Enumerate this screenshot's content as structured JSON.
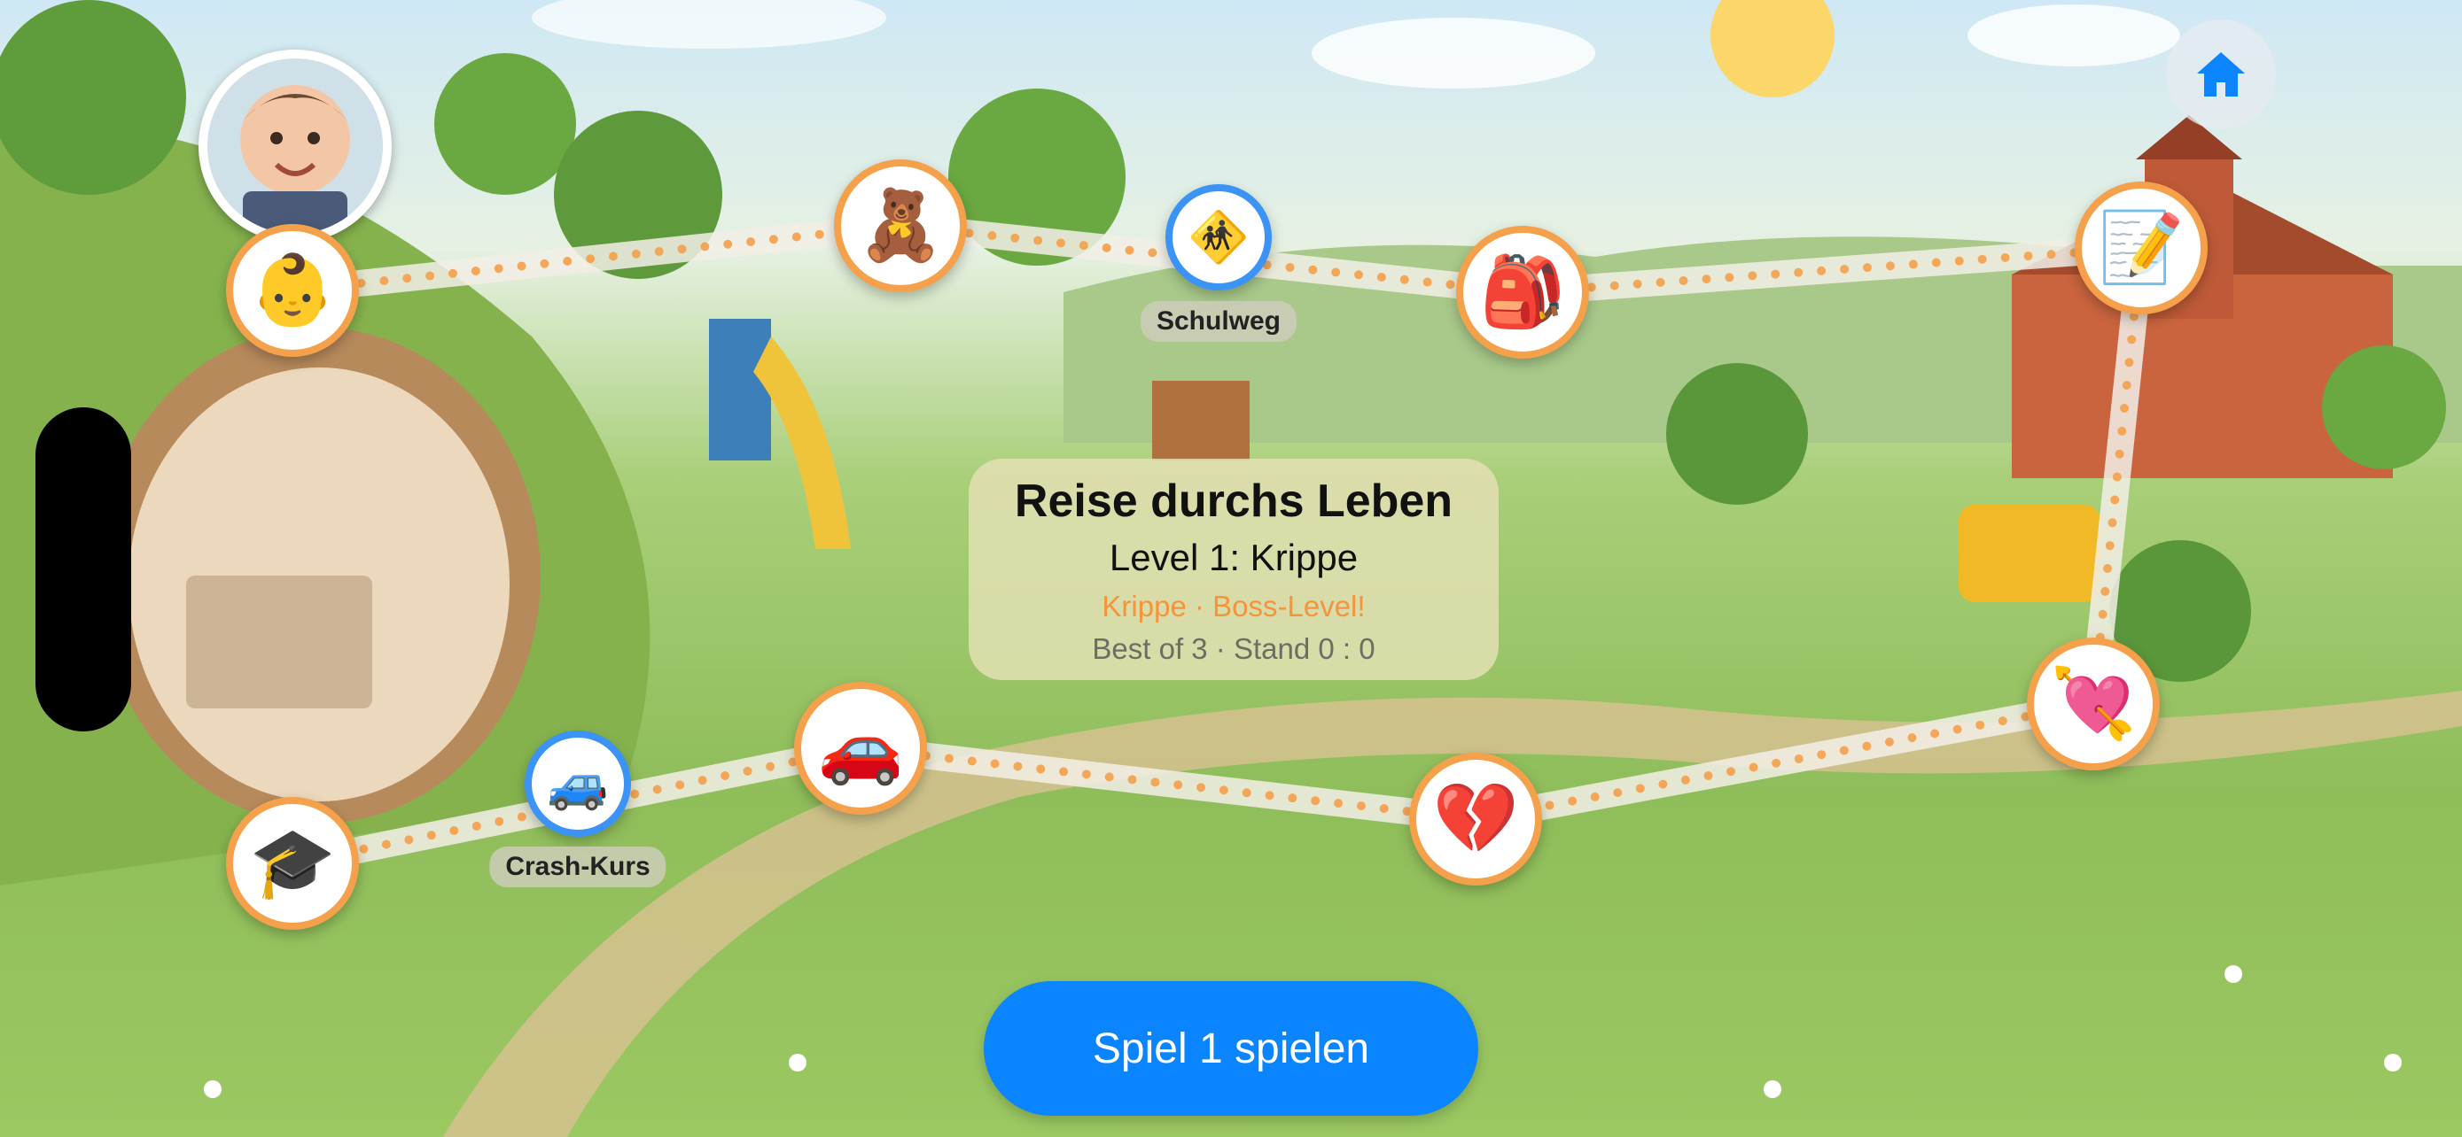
{
  "title": "Reise durchs Leben",
  "level": "Level 1: Krippe",
  "boss_text": "Krippe · Boss-Level!",
  "score_text": "Best of 3 · Stand 0 : 0",
  "play_button": "Spiel 1 spielen",
  "labels": {
    "schulweg": "Schulweg",
    "crash_kurs": "Crash-Kurs"
  },
  "nodes": {
    "baby": "👶",
    "teddy": "🧸",
    "crossing": "🚸",
    "backpack": "🎒",
    "memo": "📝",
    "heart_arrow": "💘",
    "broken_heart": "💔",
    "car": "🚗",
    "small_car": "🚙",
    "grad_cap": "🎓"
  },
  "colors": {
    "node_ring": "#f5a04b",
    "special_ring": "#3b93f5",
    "accent": "#0a84ff",
    "boss": "#f5943a"
  },
  "icons": {
    "home": "home-icon",
    "avatar": "baby-avatar"
  }
}
